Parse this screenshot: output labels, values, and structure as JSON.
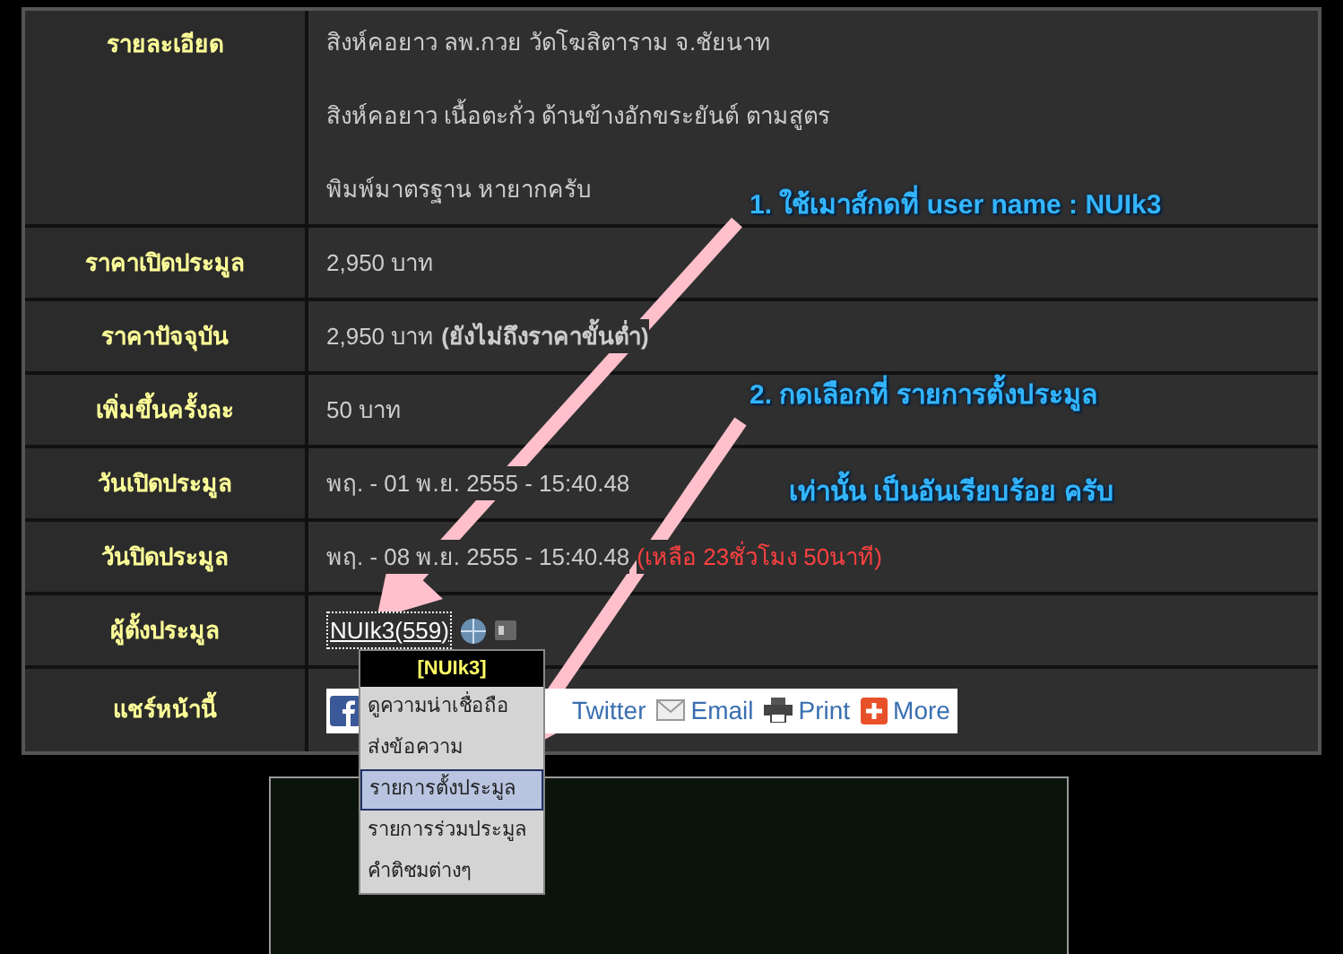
{
  "details_table": {
    "rows": [
      {
        "kind": "lines",
        "label": "รายละเอียด",
        "lines": [
          "สิงห์คอยาว ลพ.กวย วัดโฆสิตาราม จ.ชัยนาท",
          "สิงห์คอยาว เนื้อตะกั่ว ด้านข้างอักขระยันต์ ตามสูตร",
          "พิมพ์มาตรฐาน หายากครับ"
        ]
      },
      {
        "kind": "text",
        "label": "ราคาเปิดประมูล",
        "value": "2,950 บาท"
      },
      {
        "kind": "text",
        "label": "ราคาปัจจุบัน",
        "value": "2,950 บาท",
        "note": "(ยังไม่ถึงราคาขั้นต่ำ)"
      },
      {
        "kind": "text",
        "label": "เพิ่มขึ้นครั้งละ",
        "value": "50 บาท"
      },
      {
        "kind": "text",
        "label": "วันเปิดประมูล",
        "value": "พฤ. - 01 พ.ย. 2555 - 15:40.48"
      },
      {
        "kind": "text",
        "label": "วันปิดประมูล",
        "value": "พฤ. - 08 พ.ย. 2555 - 15:40.48",
        "alert": "(เหลือ 23ชั่วโมง 50นาที)"
      },
      {
        "kind": "user",
        "label": "ผู้ตั้งประมูล",
        "value": "NUIk3(559)"
      },
      {
        "kind": "share",
        "label": "แชร์หน้านี้",
        "links": [
          "Twitter",
          "Email",
          "Print",
          "More"
        ]
      }
    ]
  },
  "user_menu": {
    "title": "[NUIk3]",
    "items": [
      {
        "label": "ดูความน่าเชื่อถือ",
        "selected": false
      },
      {
        "label": "ส่งข้อความ",
        "selected": false
      },
      {
        "label": "รายการตั้งประมูล",
        "selected": true
      },
      {
        "label": "รายการร่วมประมูล",
        "selected": false
      },
      {
        "label": "คำติชมต่างๆ",
        "selected": false
      }
    ]
  },
  "annotations": [
    "1. ใช้เมาส์กดที่ user name : NUIk3",
    "2. กดเลือกที่ รายการตั้งประมูล",
    "เท่านั้น เป็นอันเรียบร้อย ครับ"
  ]
}
